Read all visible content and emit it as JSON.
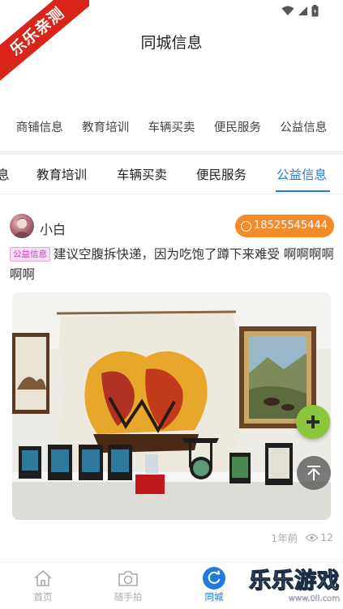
{
  "watermark": {
    "text": "乐乐亲测",
    "color": "#d9241b"
  },
  "header": {
    "title": "同城信息"
  },
  "categories": [
    "商铺信息",
    "教育培训",
    "车辆买卖",
    "便民服务",
    "公益信息"
  ],
  "tabs": {
    "items": [
      {
        "label": "息",
        "active": false
      },
      {
        "label": "教育培训",
        "active": false
      },
      {
        "label": "车辆买卖",
        "active": false
      },
      {
        "label": "便民服务",
        "active": false
      },
      {
        "label": "公益信息",
        "active": true
      }
    ],
    "accent": "#1f7be0"
  },
  "post": {
    "username": "小白",
    "phone": "18525545444",
    "tag": "公益信息",
    "text": "建议空腹拆快递，因为吃饱了蹲下来难受 啊啊啊啊啊啊",
    "time": "1年前",
    "views": "12",
    "image_icon": "art-exhibition-photo"
  },
  "fabs": {
    "add_icon": "plus-icon",
    "add_color": "#8bc63c",
    "top_icon": "back-to-top-icon"
  },
  "bottom_nav": [
    {
      "label": "首页",
      "icon": "home-icon",
      "active": false
    },
    {
      "label": "随手拍",
      "icon": "camera-icon",
      "active": false
    },
    {
      "label": "同城",
      "icon": "refresh-circle-icon",
      "active": true
    }
  ],
  "corner_logo": {
    "title": "乐乐游戏",
    "url": "www.0ll.com"
  },
  "colors": {
    "phone_badge": "#f58a2a",
    "tag_text": "#d23fb9",
    "tag_bg": "#f3dff1"
  }
}
